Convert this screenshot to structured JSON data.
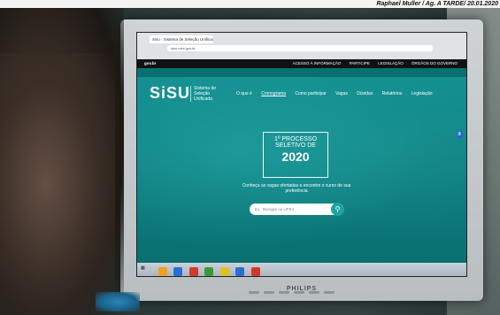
{
  "photo_credit": "Raphael Muller / Ag. A TARDE/ 20.01.2020",
  "browser": {
    "tab_title": "Sisu - Sistema de Seleção Unificada",
    "url": "sisu.mec.gov.br"
  },
  "gov_bar": {
    "brand": "gov.br",
    "links": [
      "ACESSO À INFORMAÇÃO",
      "PARTICIPE",
      "LEGISLAÇÃO",
      "ÓRGÃOS DO GOVERNO"
    ]
  },
  "site": {
    "logo": "SiSU",
    "tagline": "Sistema de Seleção Unificada",
    "nav": [
      "O que é",
      "Cronograma",
      "Como participar",
      "Vagas",
      "Dúvidas",
      "Relatórios",
      "Legislação"
    ],
    "badge_line1": "1º PROCESSO",
    "badge_line2": "SELETIVO DE",
    "badge_year": "2020",
    "intro": "Conheça as vagas ofertadas e encontre o curso de sua preferência",
    "search_placeholder": "Ex.: Biologia ou UFRJ"
  },
  "monitor": {
    "brand": "PHILIPS"
  },
  "colors": {
    "site_teal": "#0d7c7e",
    "gov_bar": "#111111",
    "accent_button": "#1aa6a0"
  }
}
